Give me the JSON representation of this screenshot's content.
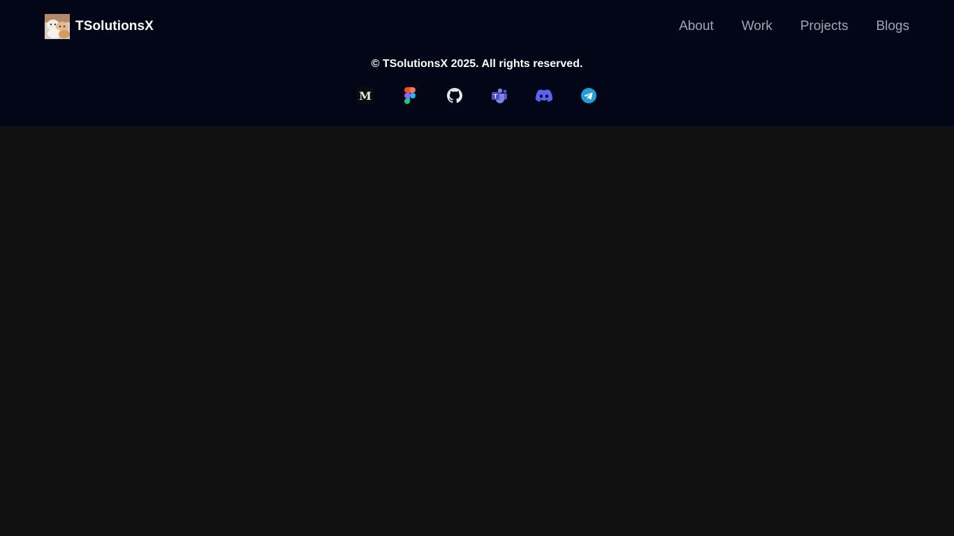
{
  "header": {
    "brand_name": "TSolutionsX",
    "avatar_icon": "cats-avatar-icon",
    "nav": [
      {
        "label": "About"
      },
      {
        "label": "Work"
      },
      {
        "label": "Projects"
      },
      {
        "label": "Blogs"
      }
    ]
  },
  "footer": {
    "copyright": "© TSolutionsX 2025. All rights reserved.",
    "socials": [
      {
        "icon": "medium-icon",
        "letter": "M"
      },
      {
        "icon": "figma-icon"
      },
      {
        "icon": "github-icon"
      },
      {
        "icon": "teams-icon",
        "letter": "T"
      },
      {
        "icon": "discord-icon"
      },
      {
        "icon": "telegram-icon"
      }
    ]
  },
  "colors": {
    "header_bg": "#030617",
    "page_bg": "#111111",
    "nav_text": "#a3a6b4",
    "discord": "#5865f2",
    "telegram": "#229ed9",
    "teams": "#5059c9"
  }
}
